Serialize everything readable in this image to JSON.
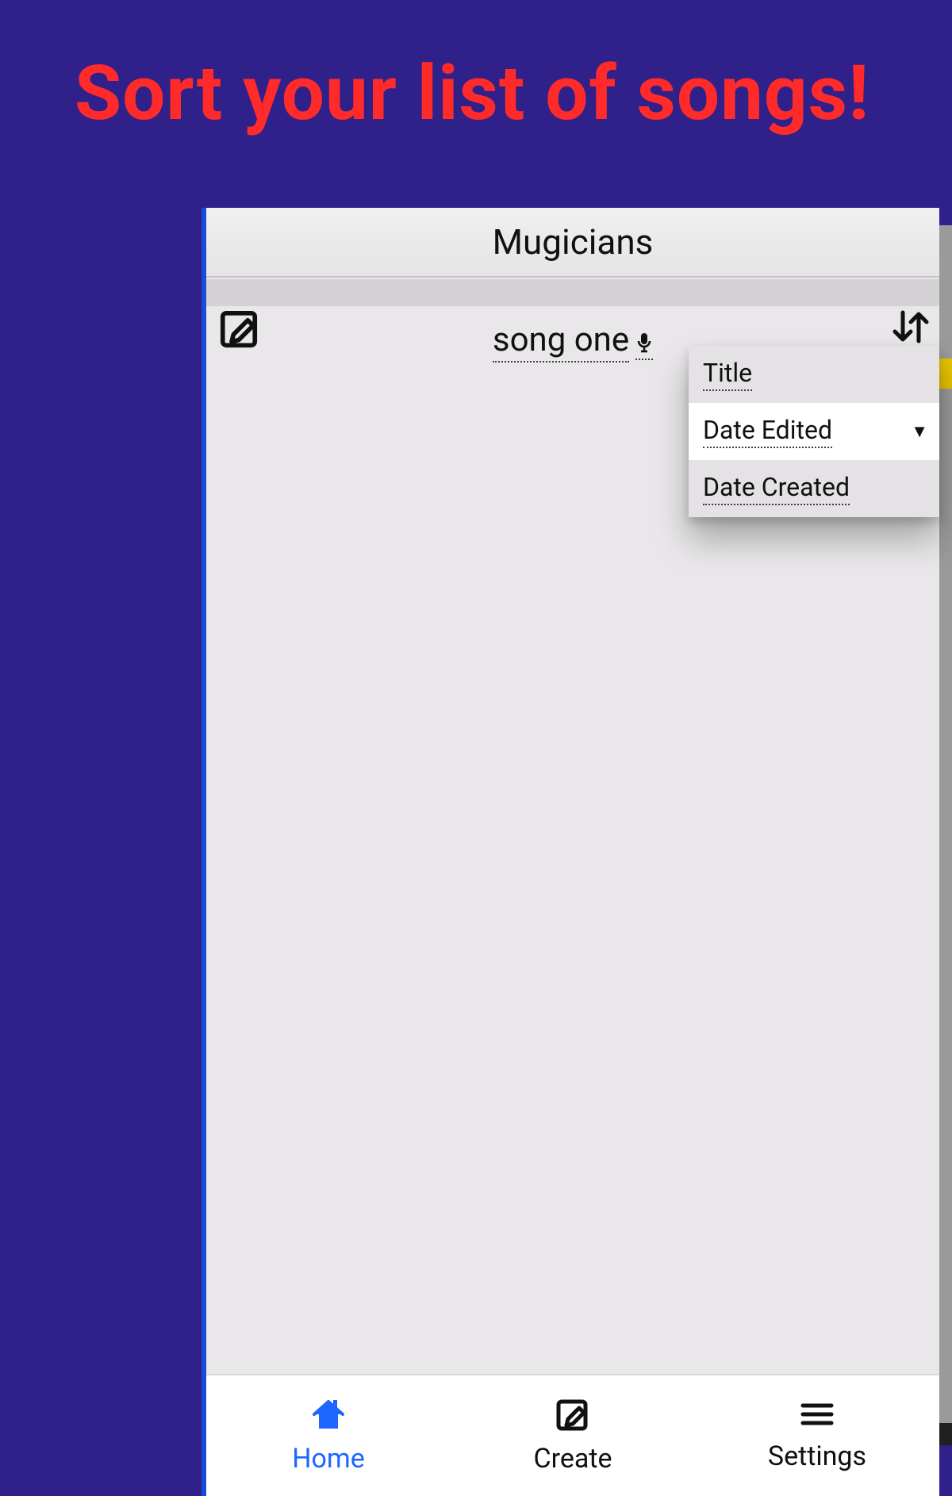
{
  "headline": "Sort your list of songs!",
  "app": {
    "title": "Mugicians"
  },
  "songs": [
    {
      "title": "song one",
      "has_audio": true
    }
  ],
  "sort_menu": {
    "options": [
      {
        "label": "Title",
        "selected": false
      },
      {
        "label": "Date Edited",
        "selected": true
      },
      {
        "label": "Date Created",
        "selected": false
      }
    ]
  },
  "nav": {
    "home": {
      "label": "Home",
      "active": true
    },
    "create": {
      "label": "Create",
      "active": false
    },
    "settings": {
      "label": "Settings",
      "active": false
    }
  },
  "icons": {
    "edit": "edit-icon",
    "sort": "sort-arrows-icon",
    "mic": "microphone-icon",
    "home": "home-icon",
    "create": "compose-icon",
    "menu": "hamburger-icon"
  }
}
